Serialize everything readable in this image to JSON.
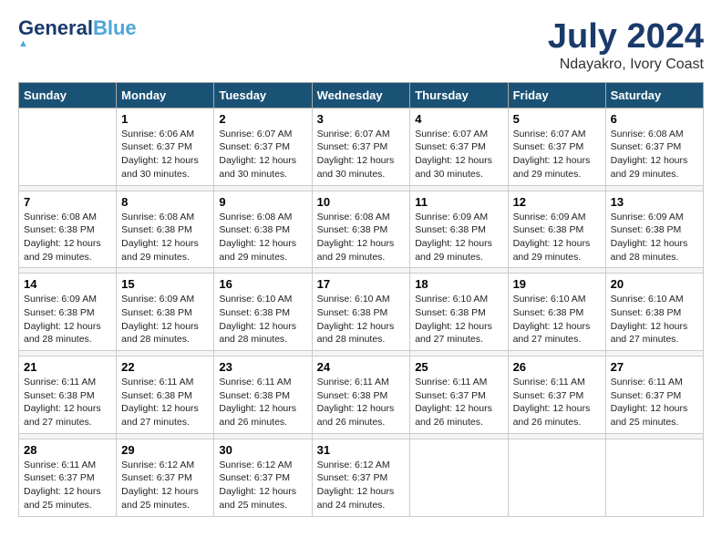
{
  "header": {
    "logo_line1": "General",
    "logo_line1_blue": "Blue",
    "month_year": "July 2024",
    "location": "Ndayakro, Ivory Coast"
  },
  "weekdays": [
    "Sunday",
    "Monday",
    "Tuesday",
    "Wednesday",
    "Thursday",
    "Friday",
    "Saturday"
  ],
  "weeks": [
    [
      {
        "day": "",
        "info": ""
      },
      {
        "day": "1",
        "info": "Sunrise: 6:06 AM\nSunset: 6:37 PM\nDaylight: 12 hours\nand 30 minutes."
      },
      {
        "day": "2",
        "info": "Sunrise: 6:07 AM\nSunset: 6:37 PM\nDaylight: 12 hours\nand 30 minutes."
      },
      {
        "day": "3",
        "info": "Sunrise: 6:07 AM\nSunset: 6:37 PM\nDaylight: 12 hours\nand 30 minutes."
      },
      {
        "day": "4",
        "info": "Sunrise: 6:07 AM\nSunset: 6:37 PM\nDaylight: 12 hours\nand 30 minutes."
      },
      {
        "day": "5",
        "info": "Sunrise: 6:07 AM\nSunset: 6:37 PM\nDaylight: 12 hours\nand 29 minutes."
      },
      {
        "day": "6",
        "info": "Sunrise: 6:08 AM\nSunset: 6:37 PM\nDaylight: 12 hours\nand 29 minutes."
      }
    ],
    [
      {
        "day": "7",
        "info": "Sunrise: 6:08 AM\nSunset: 6:38 PM\nDaylight: 12 hours\nand 29 minutes."
      },
      {
        "day": "8",
        "info": "Sunrise: 6:08 AM\nSunset: 6:38 PM\nDaylight: 12 hours\nand 29 minutes."
      },
      {
        "day": "9",
        "info": "Sunrise: 6:08 AM\nSunset: 6:38 PM\nDaylight: 12 hours\nand 29 minutes."
      },
      {
        "day": "10",
        "info": "Sunrise: 6:08 AM\nSunset: 6:38 PM\nDaylight: 12 hours\nand 29 minutes."
      },
      {
        "day": "11",
        "info": "Sunrise: 6:09 AM\nSunset: 6:38 PM\nDaylight: 12 hours\nand 29 minutes."
      },
      {
        "day": "12",
        "info": "Sunrise: 6:09 AM\nSunset: 6:38 PM\nDaylight: 12 hours\nand 29 minutes."
      },
      {
        "day": "13",
        "info": "Sunrise: 6:09 AM\nSunset: 6:38 PM\nDaylight: 12 hours\nand 28 minutes."
      }
    ],
    [
      {
        "day": "14",
        "info": "Sunrise: 6:09 AM\nSunset: 6:38 PM\nDaylight: 12 hours\nand 28 minutes."
      },
      {
        "day": "15",
        "info": "Sunrise: 6:09 AM\nSunset: 6:38 PM\nDaylight: 12 hours\nand 28 minutes."
      },
      {
        "day": "16",
        "info": "Sunrise: 6:10 AM\nSunset: 6:38 PM\nDaylight: 12 hours\nand 28 minutes."
      },
      {
        "day": "17",
        "info": "Sunrise: 6:10 AM\nSunset: 6:38 PM\nDaylight: 12 hours\nand 28 minutes."
      },
      {
        "day": "18",
        "info": "Sunrise: 6:10 AM\nSunset: 6:38 PM\nDaylight: 12 hours\nand 27 minutes."
      },
      {
        "day": "19",
        "info": "Sunrise: 6:10 AM\nSunset: 6:38 PM\nDaylight: 12 hours\nand 27 minutes."
      },
      {
        "day": "20",
        "info": "Sunrise: 6:10 AM\nSunset: 6:38 PM\nDaylight: 12 hours\nand 27 minutes."
      }
    ],
    [
      {
        "day": "21",
        "info": "Sunrise: 6:11 AM\nSunset: 6:38 PM\nDaylight: 12 hours\nand 27 minutes."
      },
      {
        "day": "22",
        "info": "Sunrise: 6:11 AM\nSunset: 6:38 PM\nDaylight: 12 hours\nand 27 minutes."
      },
      {
        "day": "23",
        "info": "Sunrise: 6:11 AM\nSunset: 6:38 PM\nDaylight: 12 hours\nand 26 minutes."
      },
      {
        "day": "24",
        "info": "Sunrise: 6:11 AM\nSunset: 6:38 PM\nDaylight: 12 hours\nand 26 minutes."
      },
      {
        "day": "25",
        "info": "Sunrise: 6:11 AM\nSunset: 6:37 PM\nDaylight: 12 hours\nand 26 minutes."
      },
      {
        "day": "26",
        "info": "Sunrise: 6:11 AM\nSunset: 6:37 PM\nDaylight: 12 hours\nand 26 minutes."
      },
      {
        "day": "27",
        "info": "Sunrise: 6:11 AM\nSunset: 6:37 PM\nDaylight: 12 hours\nand 25 minutes."
      }
    ],
    [
      {
        "day": "28",
        "info": "Sunrise: 6:11 AM\nSunset: 6:37 PM\nDaylight: 12 hours\nand 25 minutes."
      },
      {
        "day": "29",
        "info": "Sunrise: 6:12 AM\nSunset: 6:37 PM\nDaylight: 12 hours\nand 25 minutes."
      },
      {
        "day": "30",
        "info": "Sunrise: 6:12 AM\nSunset: 6:37 PM\nDaylight: 12 hours\nand 25 minutes."
      },
      {
        "day": "31",
        "info": "Sunrise: 6:12 AM\nSunset: 6:37 PM\nDaylight: 12 hours\nand 24 minutes."
      },
      {
        "day": "",
        "info": ""
      },
      {
        "day": "",
        "info": ""
      },
      {
        "day": "",
        "info": ""
      }
    ]
  ]
}
